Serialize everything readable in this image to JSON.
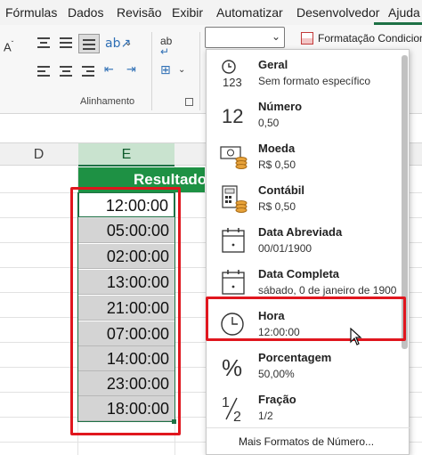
{
  "ribbon_tabs": [
    "Fórmulas",
    "Dados",
    "Revisão",
    "Exibir",
    "Automatizar",
    "Desenvolvedor",
    "Ajuda"
  ],
  "ribbon": {
    "alignment_group_label": "Alinhamento",
    "number_format_value": "",
    "conditional_formatting_label": "Formatação Condicional",
    "font_size_icon_label": "A",
    "wrap_icon_label": "ab"
  },
  "columns": [
    "D",
    "E"
  ],
  "selected_column": "E",
  "sheet": {
    "result_header": "Resultado",
    "cells": [
      "12:00:00",
      "05:00:00",
      "02:00:00",
      "13:00:00",
      "21:00:00",
      "07:00:00",
      "14:00:00",
      "23:00:00",
      "18:00:00"
    ]
  },
  "number_format_menu": {
    "items": [
      {
        "title": "Geral",
        "subtitle": "Sem formato específico",
        "icon": "clock-123-icon"
      },
      {
        "title": "Número",
        "subtitle": "0,50",
        "icon": "number-12-icon"
      },
      {
        "title": "Moeda",
        "subtitle": "R$ 0,50",
        "icon": "currency-icon"
      },
      {
        "title": "Contábil",
        "subtitle": " R$ 0,50",
        "icon": "accounting-icon"
      },
      {
        "title": "Data Abreviada",
        "subtitle": "00/01/1900",
        "icon": "calendar-icon"
      },
      {
        "title": "Data Completa",
        "subtitle": "sábado, 0 de janeiro de 1900",
        "icon": "calendar-icon"
      },
      {
        "title": "Hora",
        "subtitle": "12:00:00",
        "icon": "clock-icon"
      },
      {
        "title": "Porcentagem",
        "subtitle": "50,00%",
        "icon": "percent-icon"
      },
      {
        "title": "Fração",
        "subtitle": " 1/2",
        "icon": "fraction-icon"
      }
    ],
    "more_formats": "Mais Formatos de Número...",
    "highlighted_item": "Hora"
  },
  "colors": {
    "accent": "#1e7145",
    "header_green": "#1e9144",
    "highlight_red": "#e0161e"
  }
}
